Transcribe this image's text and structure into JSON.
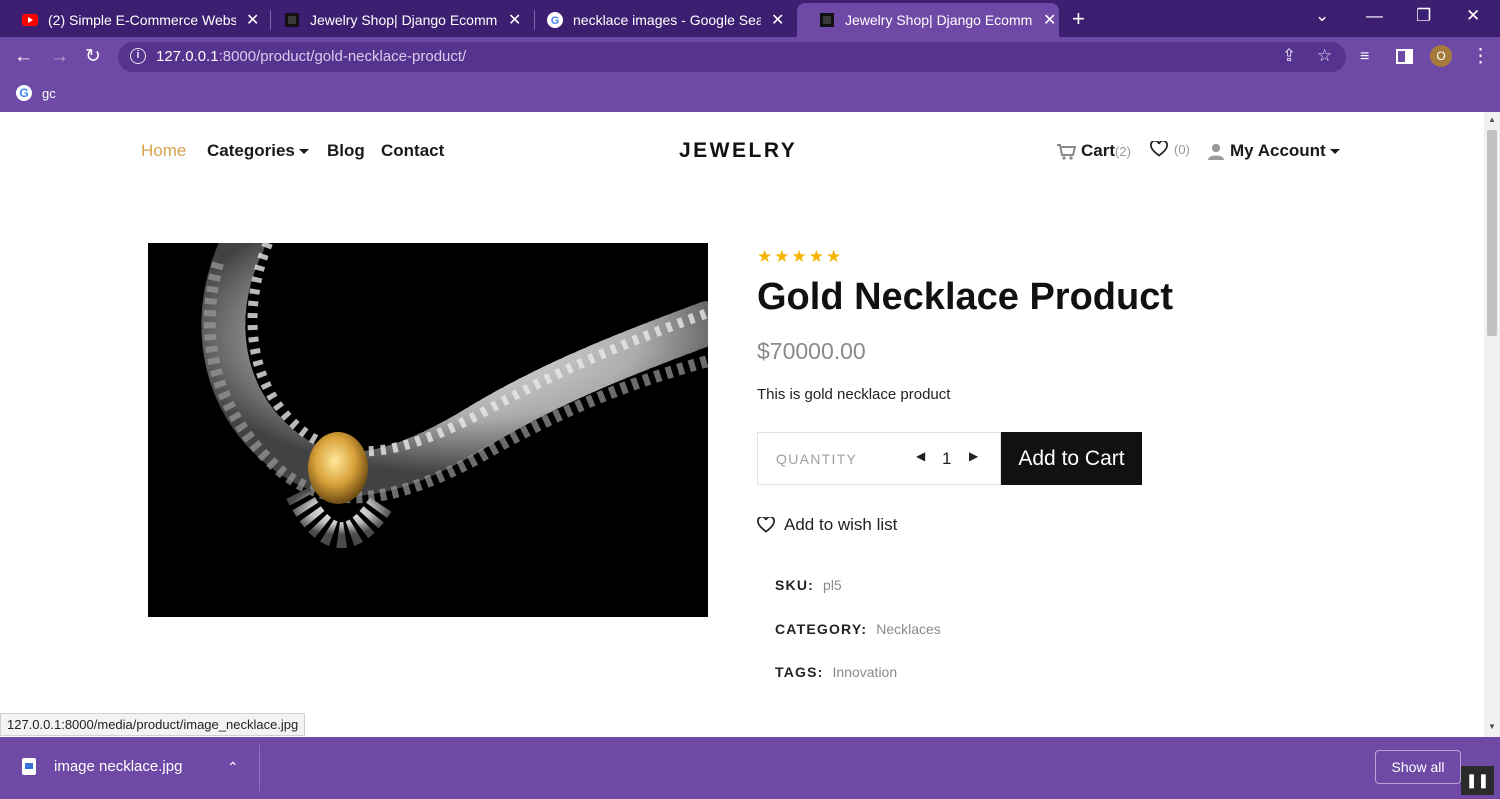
{
  "browser": {
    "tabs": [
      {
        "title": "(2) Simple E-Commerce Website",
        "favicon": "youtube-icon"
      },
      {
        "title": "Jewelry Shop| Django Ecommerce",
        "favicon": "page-icon"
      },
      {
        "title": "necklace images - Google Search",
        "favicon": "google-icon"
      },
      {
        "title": "Jewelry Shop| Django Ecommerce",
        "favicon": "page-icon"
      }
    ],
    "url_host": "127.0.0.1",
    "url_rest": ":8000/product/gold-necklace-product/",
    "profile_initial": "O",
    "bookmark": "gc",
    "accent": "#6e4aa6"
  },
  "site": {
    "nav": {
      "home": "Home",
      "categories": "Categories",
      "blog": "Blog",
      "contact": "Contact"
    },
    "brand": "JEWELRY",
    "cart_label": "Cart",
    "cart_count": "(2)",
    "wishlist_count": "(0)",
    "account_label": "My Account"
  },
  "product": {
    "rating": 5,
    "stars": "★★★★★",
    "title": "Gold Necklace Product",
    "price": "$70000.00",
    "description": "This is gold necklace product",
    "quantity_label": "QUANTITY",
    "quantity": "1",
    "add_to_cart": "Add to Cart",
    "add_to_wishlist": "Add to wish list",
    "sku_label": "SKU:",
    "sku": "pl5",
    "category_label": "CATEGORY:",
    "category": "Necklaces",
    "tags_label": "TAGS:",
    "tags": "Innovation",
    "star_color": "#f5b400",
    "home_link_color": "#d8a34b"
  },
  "status_url": "127.0.0.1:8000/media/product/image_necklace.jpg",
  "download_shelf": {
    "file": "image necklace.jpg",
    "show_all": "Show all"
  }
}
